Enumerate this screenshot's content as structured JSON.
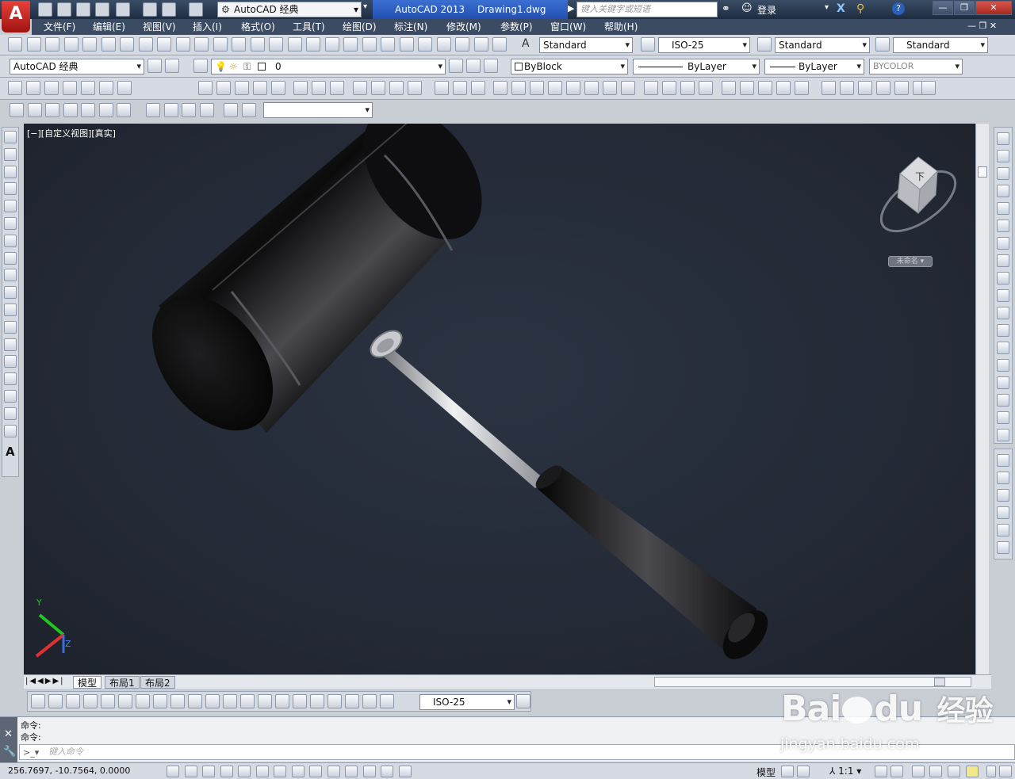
{
  "app": {
    "logo_letter": "A",
    "workspace": "AutoCAD 经典",
    "product": "AutoCAD 2013",
    "document": "Drawing1.dwg",
    "search_placeholder": "键入关键字或短语",
    "login": "登录"
  },
  "menu": [
    "文件(F)",
    "编辑(E)",
    "视图(V)",
    "插入(I)",
    "格式(O)",
    "工具(T)",
    "绘图(D)",
    "标注(N)",
    "修改(M)",
    "参数(P)",
    "窗口(W)",
    "帮助(H)"
  ],
  "styles": {
    "text_style": "Standard",
    "dim_style": "ISO-25",
    "table_style": "Standard",
    "multileader_style": "Standard"
  },
  "workspace_select": "AutoCAD 经典",
  "layer": {
    "name": "0"
  },
  "properties": {
    "color": "ByBlock",
    "linetype": "ByLayer",
    "lineweight": "ByLayer",
    "plotstyle": "BYCOLOR"
  },
  "viewport": {
    "label": "[−][自定义视图][真实]",
    "viewcube_label": "未命名",
    "viewcube_face": "下",
    "ucs_y": "Y",
    "ucs_z": "Z",
    "background": "#232935"
  },
  "tabs": [
    "模型",
    "布局1",
    "布局2"
  ],
  "dim_toolbar_style": "ISO-25",
  "command": {
    "history": [
      "命令:",
      "命令:"
    ],
    "input_placeholder": "键入命令"
  },
  "status": {
    "coordinates": "256.7697, -10.7564, 0.0000",
    "space": "模型",
    "scale": "1:1"
  },
  "watermark": {
    "brand": "Bai",
    "brand2": "du",
    "jingyan": "经验",
    "url": "jingyan.baidu.com"
  },
  "colors": {
    "title_bar": "#1e2c40",
    "menu_bar": "#3a4b63",
    "toolbar": "#d6dbe3",
    "accent_active": "#2350b0"
  }
}
